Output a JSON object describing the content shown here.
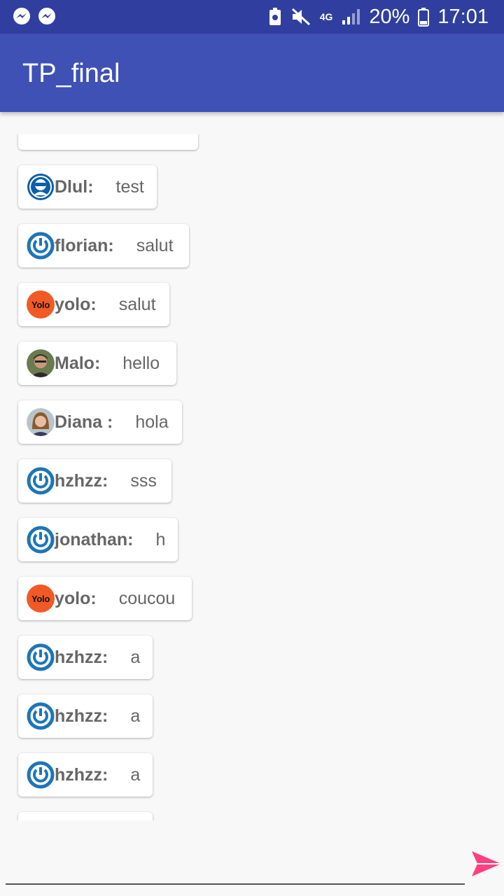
{
  "status_bar": {
    "battery": "20%",
    "time": "17:01",
    "network": "4G"
  },
  "app": {
    "title": "TP_final"
  },
  "messages": [
    {
      "author": "",
      "text": "",
      "avatar": "none"
    },
    {
      "author": "Dlul:",
      "text": "test",
      "avatar": "dlul"
    },
    {
      "author": "florian:",
      "text": "salut",
      "avatar": "power"
    },
    {
      "author": "yolo:",
      "text": "salut",
      "avatar": "yolo"
    },
    {
      "author": "Malo:",
      "text": "hello",
      "avatar": "photo-malo"
    },
    {
      "author": "Diana :",
      "text": "hola",
      "avatar": "photo-diana"
    },
    {
      "author": "hzhzz:",
      "text": "sss",
      "avatar": "power"
    },
    {
      "author": "jonathan:",
      "text": "h",
      "avatar": "power"
    },
    {
      "author": "yolo:",
      "text": "coucou",
      "avatar": "yolo"
    },
    {
      "author": "hzhzz:",
      "text": "a",
      "avatar": "power"
    },
    {
      "author": "hzhzz:",
      "text": "a",
      "avatar": "power"
    },
    {
      "author": "hzhzz:",
      "text": "a",
      "avatar": "power"
    }
  ],
  "yolo_badge": "Yolo",
  "colors": {
    "primary": "#3f51b5",
    "primary_dark": "#303f9f",
    "accent": "#ff4081"
  },
  "icons": {
    "send": "send-icon",
    "messenger": "messenger-icon"
  }
}
